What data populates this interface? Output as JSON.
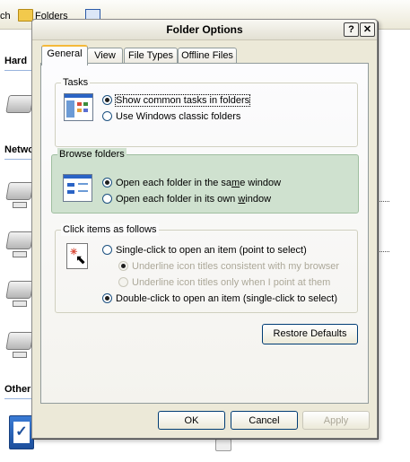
{
  "background": {
    "toolbar": {
      "back_text": "ch",
      "folders_label": "Folders"
    },
    "sidebar": {
      "section1": "Hard",
      "section2": "Netwo",
      "section3": "Other"
    }
  },
  "dialog": {
    "title": "Folder Options",
    "help_glyph": "?",
    "close_glyph": "✕",
    "tabs": [
      {
        "label": "General"
      },
      {
        "label": "View"
      },
      {
        "label": "File Types"
      },
      {
        "label": "Offline Files"
      }
    ],
    "tasks": {
      "title": "Tasks",
      "options": [
        {
          "label": "Show common tasks in folders",
          "checked": true
        },
        {
          "label": "Use Windows classic folders",
          "checked": false
        }
      ]
    },
    "browse": {
      "title": "Browse folders",
      "options": [
        {
          "pre": "Open each folder in the sa",
          "ul": "m",
          "post": "e window",
          "checked": true
        },
        {
          "pre": "Open each folder in its own ",
          "ul": "w",
          "post": "indow",
          "checked": false
        }
      ]
    },
    "click": {
      "title": "Click items as follows",
      "single": {
        "label": "Single-click to open an item (point to select)",
        "checked": false
      },
      "underline_browser": {
        "label": "Underline icon titles consistent with my browser",
        "checked": true
      },
      "underline_point": {
        "label": "Underline icon titles only when I point at them",
        "checked": false
      },
      "double": {
        "label": "Double-click to open an item (single-click to select)",
        "checked": true
      }
    },
    "restore_label": "Restore Defaults",
    "ok_label": "OK",
    "cancel_label": "Cancel",
    "apply_label": "Apply"
  }
}
